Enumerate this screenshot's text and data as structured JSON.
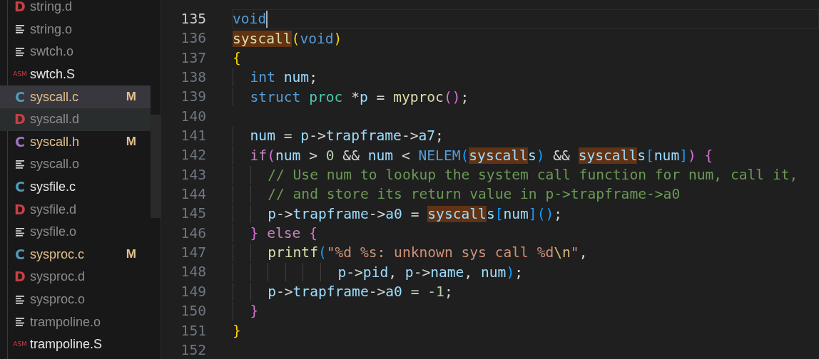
{
  "explorer": {
    "files": [
      {
        "name": "string.d",
        "kind": "dep",
        "glyph": "D",
        "modified": false,
        "ignored": true,
        "selected": false,
        "hovered": false
      },
      {
        "name": "string.o",
        "kind": "object",
        "modified": false,
        "ignored": true,
        "selected": false,
        "hovered": false
      },
      {
        "name": "swtch.o",
        "kind": "object",
        "modified": false,
        "ignored": true,
        "selected": false,
        "hovered": false
      },
      {
        "name": "swtch.S",
        "kind": "asm",
        "glyph": "ASM",
        "modified": false,
        "ignored": false,
        "selected": false,
        "hovered": false
      },
      {
        "name": "syscall.c",
        "kind": "c",
        "glyph": "C",
        "modified": true,
        "badge": "M",
        "ignored": false,
        "selected": true,
        "hovered": false
      },
      {
        "name": "syscall.d",
        "kind": "dep",
        "glyph": "D",
        "modified": false,
        "ignored": true,
        "selected": false,
        "hovered": true
      },
      {
        "name": "syscall.h",
        "kind": "h",
        "glyph": "C",
        "modified": true,
        "badge": "M",
        "ignored": false,
        "selected": false,
        "hovered": false
      },
      {
        "name": "syscall.o",
        "kind": "object",
        "modified": false,
        "ignored": true,
        "selected": false,
        "hovered": false
      },
      {
        "name": "sysfile.c",
        "kind": "c",
        "glyph": "C",
        "modified": false,
        "ignored": false,
        "selected": false,
        "hovered": false
      },
      {
        "name": "sysfile.d",
        "kind": "dep",
        "glyph": "D",
        "modified": false,
        "ignored": true,
        "selected": false,
        "hovered": false
      },
      {
        "name": "sysfile.o",
        "kind": "object",
        "modified": false,
        "ignored": true,
        "selected": false,
        "hovered": false
      },
      {
        "name": "sysproc.c",
        "kind": "c",
        "glyph": "C",
        "modified": true,
        "badge": "M",
        "ignored": false,
        "selected": false,
        "hovered": false
      },
      {
        "name": "sysproc.d",
        "kind": "dep",
        "glyph": "D",
        "modified": false,
        "ignored": true,
        "selected": false,
        "hovered": false
      },
      {
        "name": "sysproc.o",
        "kind": "object",
        "modified": false,
        "ignored": true,
        "selected": false,
        "hovered": false
      },
      {
        "name": "trampoline.o",
        "kind": "object",
        "modified": false,
        "ignored": true,
        "selected": false,
        "hovered": false
      },
      {
        "name": "trampoline.S",
        "kind": "asm",
        "glyph": "ASM",
        "modified": false,
        "ignored": false,
        "selected": false,
        "hovered": false
      }
    ]
  },
  "editor": {
    "lines": [
      {
        "number": "135",
        "current": true,
        "tokens": [
          {
            "t": "void",
            "kind": "kw"
          }
        ]
      },
      {
        "number": "136",
        "current": false,
        "tokens": [
          {
            "t": "syscall",
            "kind": "fn-hl"
          },
          {
            "t": "(",
            "kind": "b1"
          },
          {
            "t": "void",
            "kind": "kw"
          },
          {
            "t": ")",
            "kind": "b1"
          }
        ]
      },
      {
        "number": "137",
        "current": false,
        "tokens": [
          {
            "t": "{",
            "kind": "b1"
          }
        ]
      },
      {
        "number": "138",
        "current": false,
        "tokens": [
          {
            "t": "  int",
            "kind": "kw"
          },
          {
            "t": " num",
            "kind": "var"
          },
          {
            "t": ";",
            "kind": "op"
          }
        ]
      },
      {
        "number": "139",
        "current": false,
        "tokens": [
          {
            "t": "  struct",
            "kind": "kw"
          },
          {
            "t": " proc",
            "kind": "type"
          },
          {
            "t": " *",
            "kind": "op"
          },
          {
            "t": "p",
            "kind": "var"
          },
          {
            "t": " = ",
            "kind": "op"
          },
          {
            "t": "myproc",
            "kind": "fn"
          },
          {
            "t": "()",
            "kind": "b2"
          },
          {
            "t": ";",
            "kind": "op"
          }
        ]
      },
      {
        "number": "140",
        "current": false
      },
      {
        "number": "141",
        "current": false,
        "tokens": [
          {
            "t": "  num",
            "kind": "var"
          },
          {
            "t": " = ",
            "kind": "op"
          },
          {
            "t": "p",
            "kind": "var"
          },
          {
            "t": "->",
            "kind": "op"
          },
          {
            "t": "trapframe",
            "kind": "var"
          },
          {
            "t": "->",
            "kind": "op"
          },
          {
            "t": "a7",
            "kind": "var"
          },
          {
            "t": ";",
            "kind": "op"
          }
        ]
      },
      {
        "number": "142",
        "current": false,
        "tokens": [
          {
            "t": "  if",
            "kind": "ctl"
          },
          {
            "t": "(",
            "kind": "b2"
          },
          {
            "t": "num",
            "kind": "var"
          },
          {
            "t": " > ",
            "kind": "op"
          },
          {
            "t": "0",
            "kind": "num"
          },
          {
            "t": " && ",
            "kind": "op"
          },
          {
            "t": "num",
            "kind": "var"
          },
          {
            "t": " < ",
            "kind": "op"
          },
          {
            "t": "NELEM",
            "kind": "kw"
          },
          {
            "t": "(",
            "kind": "b3"
          },
          {
            "t": "syscall",
            "kind": "var-hl"
          },
          {
            "t": "s",
            "kind": "var"
          },
          {
            "t": ")",
            "kind": "b3"
          },
          {
            "t": " && ",
            "kind": "op"
          },
          {
            "t": "syscall",
            "kind": "var-hl"
          },
          {
            "t": "s",
            "kind": "var"
          },
          {
            "t": "[",
            "kind": "b3"
          },
          {
            "t": "num",
            "kind": "var"
          },
          {
            "t": "]",
            "kind": "b3"
          },
          {
            "t": ") {",
            "kind": "b2"
          }
        ]
      },
      {
        "number": "143",
        "current": false,
        "tokens": [
          {
            "t": "    // Use num to lookup the system call function for num, call it,",
            "kind": "comment"
          }
        ]
      },
      {
        "number": "144",
        "current": false,
        "tokens": [
          {
            "t": "    // and store its return value in p->trapframe->a0",
            "kind": "comment"
          }
        ]
      },
      {
        "number": "145",
        "current": false,
        "tokens": [
          {
            "t": "    p",
            "kind": "var"
          },
          {
            "t": "->",
            "kind": "op"
          },
          {
            "t": "trapframe",
            "kind": "var"
          },
          {
            "t": "->",
            "kind": "op"
          },
          {
            "t": "a0",
            "kind": "var"
          },
          {
            "t": " = ",
            "kind": "op"
          },
          {
            "t": "syscall",
            "kind": "var-hl"
          },
          {
            "t": "s",
            "kind": "var"
          },
          {
            "t": "[",
            "kind": "b3"
          },
          {
            "t": "num",
            "kind": "var"
          },
          {
            "t": "]()",
            "kind": "b3"
          },
          {
            "t": ";",
            "kind": "op"
          }
        ]
      },
      {
        "number": "146",
        "current": false,
        "tokens": [
          {
            "t": "  }",
            "kind": "b2"
          },
          {
            "t": " else",
            "kind": "ctl"
          },
          {
            "t": " {",
            "kind": "b2"
          }
        ]
      },
      {
        "number": "147",
        "current": false,
        "tokens": [
          {
            "t": "    printf",
            "kind": "fn"
          },
          {
            "t": "(",
            "kind": "b3"
          },
          {
            "t": "\"%d %s: unknown sys call %d",
            "kind": "str"
          },
          {
            "t": "\\n",
            "kind": "esc"
          },
          {
            "t": "\"",
            "kind": "str"
          },
          {
            "t": ",",
            "kind": "op"
          }
        ]
      },
      {
        "number": "148",
        "current": false,
        "tokens": [
          {
            "t": "            p",
            "kind": "var"
          },
          {
            "t": "->",
            "kind": "op"
          },
          {
            "t": "pid",
            "kind": "var"
          },
          {
            "t": ", ",
            "kind": "op"
          },
          {
            "t": "p",
            "kind": "var"
          },
          {
            "t": "->",
            "kind": "op"
          },
          {
            "t": "name",
            "kind": "var"
          },
          {
            "t": ", ",
            "kind": "op"
          },
          {
            "t": "num",
            "kind": "var"
          },
          {
            "t": ")",
            "kind": "b3"
          },
          {
            "t": ";",
            "kind": "op"
          }
        ]
      },
      {
        "number": "149",
        "current": false,
        "tokens": [
          {
            "t": "    p",
            "kind": "var"
          },
          {
            "t": "->",
            "kind": "op"
          },
          {
            "t": "trapframe",
            "kind": "var"
          },
          {
            "t": "->",
            "kind": "op"
          },
          {
            "t": "a0",
            "kind": "var"
          },
          {
            "t": " = ",
            "kind": "op"
          },
          {
            "t": "-1",
            "kind": "num"
          },
          {
            "t": ";",
            "kind": "op"
          }
        ]
      },
      {
        "number": "150",
        "current": false,
        "tokens": [
          {
            "t": "  }",
            "kind": "b2"
          }
        ]
      },
      {
        "number": "151",
        "current": false,
        "tokens": [
          {
            "t": "}",
            "kind": "b1"
          }
        ]
      },
      {
        "number": "152",
        "current": false
      }
    ]
  }
}
